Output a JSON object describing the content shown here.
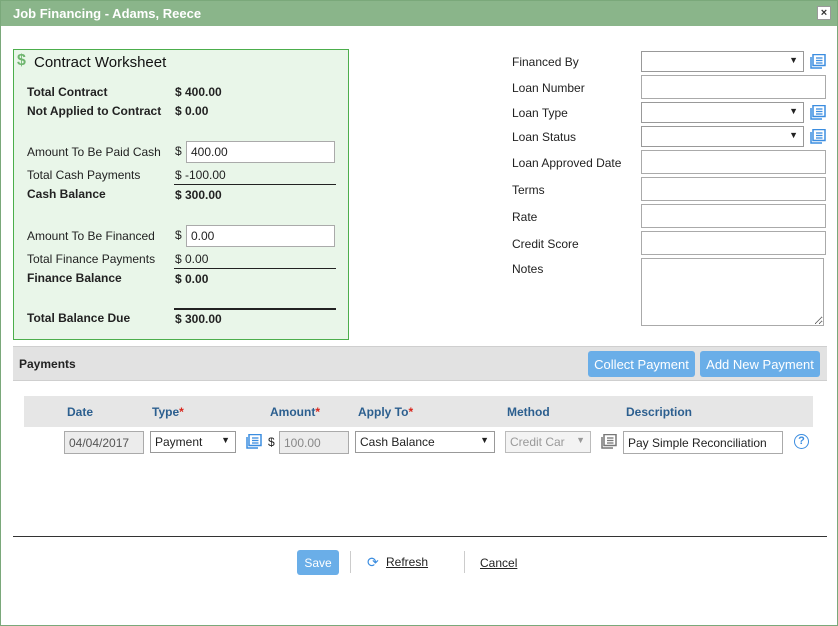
{
  "window": {
    "title": "Job Financing - Adams, Reece",
    "close_label": "×"
  },
  "worksheet": {
    "title": "Contract Worksheet",
    "total_contract_label": "Total Contract",
    "total_contract_value": "$ 400.00",
    "not_applied_label": "Not Applied to Contract",
    "not_applied_value": "$ 0.00",
    "cash_label": "Amount To Be Paid Cash",
    "cash_currency": "$",
    "cash_value": "400.00",
    "total_cash_payments_label": "Total Cash Payments",
    "total_cash_payments_value": "$ -100.00",
    "cash_balance_label": "Cash Balance",
    "cash_balance_value": "$ 300.00",
    "financed_label": "Amount To Be Financed",
    "financed_currency": "$",
    "financed_value": "0.00",
    "total_finance_payments_label": "Total Finance Payments",
    "total_finance_payments_value": "$ 0.00",
    "finance_balance_label": "Finance Balance",
    "finance_balance_value": "$ 0.00",
    "total_balance_label": "Total Balance Due",
    "total_balance_value": "$ 300.00"
  },
  "loan": {
    "financed_by_label": "Financed By",
    "financed_by_value": "",
    "loan_number_label": "Loan Number",
    "loan_number_value": "",
    "loan_type_label": "Loan Type",
    "loan_type_value": "",
    "loan_status_label": "Loan Status",
    "loan_status_value": "",
    "approved_date_label": "Loan Approved Date",
    "approved_date_value": "",
    "terms_label": "Terms",
    "terms_value": "",
    "rate_label": "Rate",
    "rate_value": "",
    "credit_score_label": "Credit Score",
    "credit_score_value": "",
    "notes_label": "Notes",
    "notes_value": ""
  },
  "payments": {
    "title": "Payments",
    "collect_button": "Collect Payment",
    "add_button": "Add New Payment",
    "columns": {
      "date": "Date",
      "type": "Type",
      "amount": "Amount",
      "apply_to": "Apply To",
      "method": "Method",
      "description": "Description",
      "required_marker": "*"
    },
    "rows": [
      {
        "date": "04/04/2017",
        "type": "Payment",
        "currency": "$",
        "amount": "100.00",
        "apply_to": "Cash Balance",
        "method": "Credit Car",
        "description": "Pay Simple Reconciliation"
      }
    ]
  },
  "footer": {
    "save": "Save",
    "refresh": "Refresh",
    "cancel": "Cancel"
  },
  "colors": {
    "title_bar": "#8ab58a",
    "worksheet_bg": "#e9f6e9",
    "worksheet_border": "#4cae4c",
    "accent_button": "#6aaee8",
    "column_header": "#2c5f8f",
    "required": "#d9261c"
  },
  "icons": {
    "dollar": "dollar-icon",
    "list": "list-icon",
    "help": "help-icon",
    "refresh": "refresh-icon",
    "dropdown": "chevron-down-icon"
  }
}
